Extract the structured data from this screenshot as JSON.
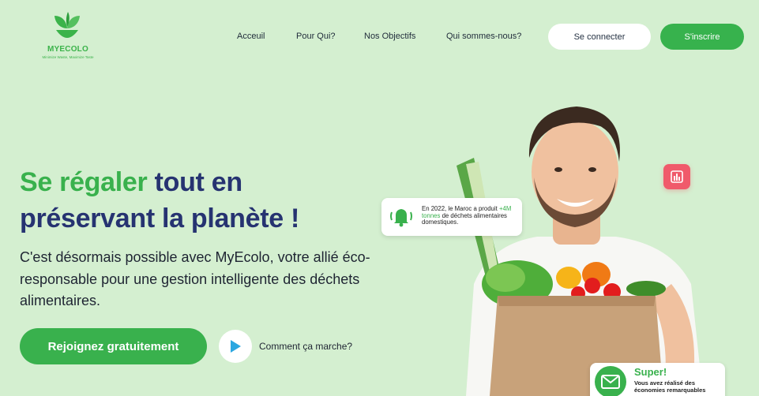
{
  "brand": {
    "name": "MYECOLO",
    "tagline": "Minimize Waste, Maximize Taste"
  },
  "nav": {
    "items": [
      {
        "label": "Acceuil"
      },
      {
        "label": "Pour Qui?"
      },
      {
        "label": "Nos Objectifs"
      },
      {
        "label": "Qui sommes-nous?"
      }
    ],
    "login_label": "Se connecter",
    "signup_label": "S'inscrire"
  },
  "hero": {
    "title_green": "Se régaler",
    "title_rest": " tout en",
    "title_line2": "préservant la planète !",
    "subtitle": "C'est désormais possible avec MyEcolo, votre allié éco-responsable pour une gestion intelligente des déchets alimentaires.",
    "cta_label": "Rejoignez gratuitement",
    "how_label": "Comment ça marche?"
  },
  "stat_card": {
    "text_before": "En 2022, le Maroc a produit ",
    "highlight": "+4M tonnes",
    "text_after": " de déchets alimentaires domestiques."
  },
  "success_card": {
    "title": "Super!",
    "text": "Vous avez réalisé des économies remarquables"
  },
  "icons": {
    "logo": "leaf-logo-icon",
    "play": "play-icon",
    "bell": "bell-icon",
    "chart": "bar-chart-icon",
    "mail": "mail-icon"
  },
  "colors": {
    "background": "#d4efd0",
    "green": "#39b14d",
    "navy": "#263371",
    "chart_badge": "#f05a6b"
  }
}
